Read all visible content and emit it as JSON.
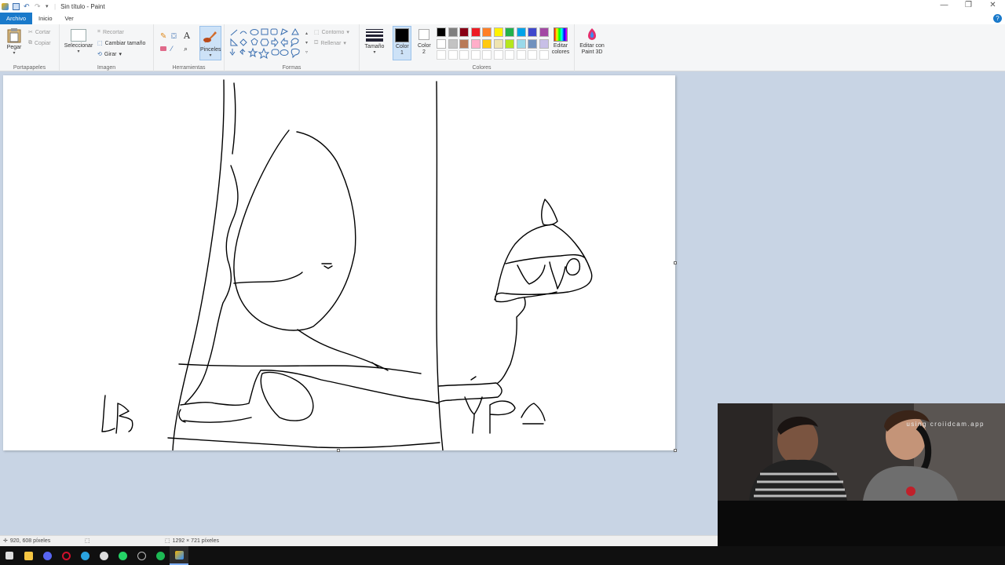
{
  "window": {
    "title": "Sin título - Paint",
    "controls": [
      "minimize-icon",
      "restore-icon",
      "close-icon"
    ]
  },
  "tabs": [
    {
      "label": "Archivo",
      "active": true
    },
    {
      "label": "Inicio"
    },
    {
      "label": "Ver"
    }
  ],
  "ribbon": {
    "clipboard": {
      "label": "Portapapeles",
      "paste": "Pegar",
      "cut": "Cortar",
      "copy": "Copiar"
    },
    "image": {
      "label": "Imagen",
      "select": "Seleccionar",
      "crop": "Recortar",
      "resize": "Cambiar tamaño",
      "rotate": "Girar"
    },
    "tools": {
      "label": "Herramientas",
      "brushes": "Pinceles"
    },
    "shapes": {
      "label": "Formas",
      "outline": "Contorno",
      "fill": "Rellenar"
    },
    "size": {
      "label": "Tamaño"
    },
    "colors": {
      "label": "Colores",
      "color1": "Color 1",
      "color2": "Color 2",
      "edit_colors": "Editar colores",
      "paint3d": "Editar con Paint 3D",
      "color1_value": "#000000",
      "color2_value": "#ffffff",
      "palette": [
        "#000000",
        "#7f7f7f",
        "#880015",
        "#ed1c24",
        "#ff7f27",
        "#fff200",
        "#22b14c",
        "#00a2e8",
        "#3f48cc",
        "#a349a4",
        "#ffffff",
        "#c3c3c3",
        "#b97a57",
        "#ffaec9",
        "#ffc90e",
        "#efe4b0",
        "#b5e61d",
        "#99d9ea",
        "#7092be",
        "#c8bfe7",
        "#ffffff",
        "#ffffff",
        "#ffffff",
        "#ffffff",
        "#ffffff",
        "#ffffff",
        "#ffffff",
        "#ffffff",
        "#ffffff",
        "#ffffff"
      ]
    }
  },
  "status": {
    "cursor": "920, 608 píxeles",
    "size": "1292 × 721 píxeles"
  },
  "webcam": {
    "watermark": "using croiidcam.app"
  },
  "taskbar": {
    "icons": [
      "windows-start-icon",
      "file-explorer-icon",
      "discord-icon",
      "opera-icon",
      "telegram-icon",
      "obs-icon",
      "whatsapp-icon",
      "app-icon",
      "spotify-icon",
      "paint-icon"
    ]
  }
}
